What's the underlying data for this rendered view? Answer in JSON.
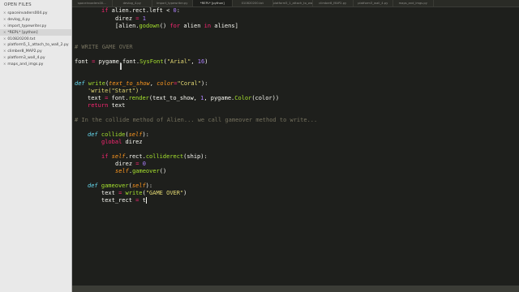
{
  "sidebar": {
    "title": "OPEN FILES",
    "files": [
      {
        "name": "spaceinvaders004.py",
        "active": false
      },
      {
        "name": "devlog_4.py",
        "active": false
      },
      {
        "name": "import_typewriter.py",
        "active": false
      },
      {
        "name": "*REPL* [python]",
        "active": true
      },
      {
        "name": "010820200.txt",
        "active": false
      },
      {
        "name": "platform5_1_attach_to_wall_2.py",
        "active": false
      },
      {
        "name": "climber8_MAP2.py",
        "active": false
      },
      {
        "name": "platform3_wall_4.py",
        "active": false
      },
      {
        "name": "maps_and_imgs.py",
        "active": false
      }
    ]
  },
  "tabs": [
    {
      "label": "spaceinvaders00...",
      "active": false
    },
    {
      "label": "devlog_4.py",
      "active": false
    },
    {
      "label": "import_typewriter.py",
      "active": false
    },
    {
      "label": "*REPL* [python]",
      "active": true
    },
    {
      "label": "010820200.txt",
      "active": false
    },
    {
      "label": "platform5_1_attach_to_wall_2.py",
      "active": false
    },
    {
      "label": "climber8_MAP2.py",
      "active": false
    },
    {
      "label": "platform3_wall_4.py",
      "active": false
    },
    {
      "label": "maps_and_imgs.py",
      "active": false
    }
  ],
  "code": {
    "l1_if": "if",
    "l1_rest": " alien.rect.left < ",
    "l1_num": "0",
    "l1_end": ":",
    "l2_a": "direz ",
    "l2_eq": "=",
    "l2_num": " 1",
    "l3_open": "[alien.",
    "l3_fn": "godown",
    "l3_mid": "() ",
    "l3_for": "for",
    "l3_alien": " alien ",
    "l3_in": "in",
    "l3_end": " aliens]",
    "c1": "# WRITE GAME OVER",
    "l5_a": "font ",
    "l5_eq": "=",
    "l5_b": " pygame.font.",
    "l5_fn": "SysFont",
    "l5_c": "(",
    "l5_str": "\"Arial\"",
    "l5_d": ", ",
    "l5_num": "16",
    "l5_e": ")",
    "l6_def": "def",
    "l6_fn": " write",
    "l6_a": "(",
    "l6_p1": "text_to_show",
    "l6_b": ", ",
    "l6_p2": "color",
    "l6_eq": "=",
    "l6_str": "\"Coral\"",
    "l6_c": "):",
    "l7_str": "'write(\"Start\")'",
    "l8_a": "text ",
    "l8_eq": "=",
    "l8_b": " font.",
    "l8_fn": "render",
    "l8_c": "(text_to_show, ",
    "l8_num": "1",
    "l8_d": ", pygame.",
    "l8_fn2": "Color",
    "l8_e": "(color))",
    "l9_kw": "return",
    "l9_rest": " text",
    "c2": "# In the collide method of Alien... we call gameover method to write...",
    "l11_def": "def",
    "l11_fn": " collide",
    "l11_a": "(",
    "l11_self": "self",
    "l11_b": "):",
    "l12_kw": "global",
    "l12_rest": " direz",
    "l14_if": "if",
    "l14_sp": " ",
    "l14_self": "self",
    "l14_a": ".rect.",
    "l14_fn": "colliderect",
    "l14_b": "(ship):",
    "l15_a": "direz ",
    "l15_eq": "=",
    "l15_num": " 0",
    "l16_self": "self",
    "l16_a": ".",
    "l16_fn": "gameover",
    "l16_b": "()",
    "l18_def": "def",
    "l18_fn": " gameover",
    "l18_a": "(",
    "l18_self": "self",
    "l18_b": "):",
    "l19_a": "text ",
    "l19_eq": "=",
    "l19_sp": " ",
    "l19_fn": "write",
    "l19_b": "(",
    "l19_str": "\"GAME OVER\"",
    "l19_c": ")",
    "l20_a": "text_rect ",
    "l20_eq": "=",
    "l20_b": " t"
  },
  "colors": {
    "background": "#1e1f1c",
    "keyword": "#f92672",
    "function": "#a6e22e",
    "string": "#e6db74",
    "number": "#ae81ff",
    "comment": "#75715e",
    "parameter": "#fd971f"
  }
}
